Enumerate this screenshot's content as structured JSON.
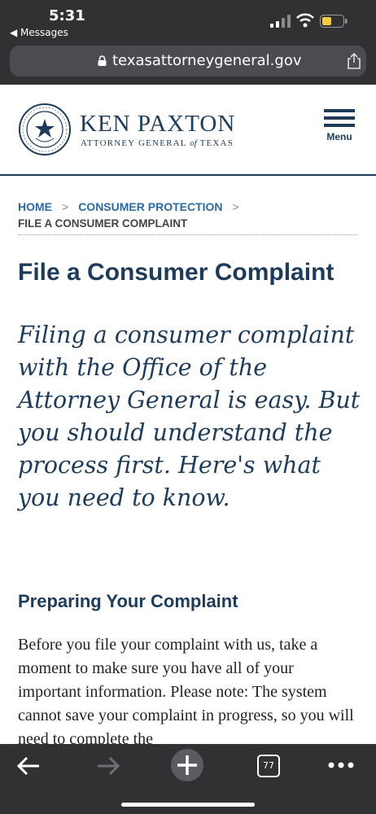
{
  "status": {
    "time": "5:31",
    "back_app": "◀ Messages"
  },
  "browser": {
    "url": "texasattorneygeneral.gov",
    "tab_count": "77"
  },
  "site": {
    "brand_name": "KEN PAXTON",
    "brand_sub_1": "ATTORNEY GENERAL ",
    "brand_sub_of": "of",
    "brand_sub_2": " TEXAS",
    "menu_label": "Menu"
  },
  "breadcrumb": {
    "home": "HOME",
    "sep": ">",
    "consumer": "CONSUMER PROTECTION",
    "current": "FILE A CONSUMER COMPLAINT"
  },
  "page": {
    "title": "File a Consumer Complaint",
    "lead": "Filing a consumer complaint with the Office of the Attorney General is easy. But you should understand the process first. Here's what you need to know.",
    "section_heading": "Preparing Your Complaint",
    "body": "Before you file your complaint with us, take a moment to make sure you have all of your important information. Please note: The system cannot save your complaint in progress, so you will need to complete the"
  },
  "colors": {
    "navy": "#1e3b5a",
    "link": "#2c6aa0",
    "chrome": "#2f3133"
  }
}
